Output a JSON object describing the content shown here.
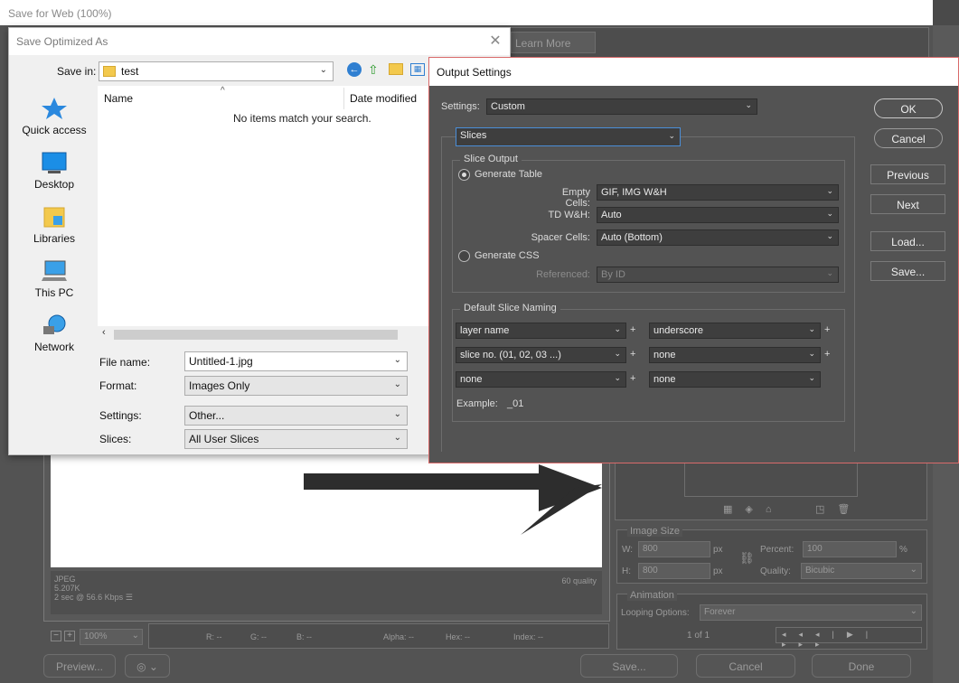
{
  "sfw": {
    "title": "Save for Web (100%)",
    "learn_more": "Learn More",
    "canvas_info": {
      "format": "JPEG",
      "size": "5.207K",
      "time": "2 sec @ 56.6 Kbps",
      "quality": "60 quality"
    },
    "zoom": "100%",
    "readouts": {
      "r": "R: --",
      "g": "G: --",
      "b": "B: --",
      "alpha": "Alpha: --",
      "hex": "Hex: --",
      "index": "Index: --"
    },
    "preview_button": "Preview...",
    "save_button": "Save...",
    "cancel_button": "Cancel",
    "done_button": "Done",
    "image_size": {
      "title": "Image Size",
      "w_label": "W:",
      "w_value": "800",
      "h_label": "H:",
      "h_value": "800",
      "unit": "px",
      "percent_label": "Percent:",
      "percent_value": "100",
      "percent_unit": "%",
      "quality_label": "Quality:",
      "quality_value": "Bicubic"
    },
    "animation": {
      "title": "Animation",
      "looping_label": "Looping Options:",
      "looping_value": "Forever",
      "frame": "1 of 1"
    }
  },
  "save_dialog": {
    "title": "Save Optimized As",
    "save_in_label": "Save in:",
    "save_in_value": "test",
    "places": [
      "Quick access",
      "Desktop",
      "Libraries",
      "This PC",
      "Network"
    ],
    "columns": {
      "name": "Name",
      "date": "Date modified"
    },
    "empty_message": "No items match your search.",
    "file_name_label": "File name:",
    "file_name_value": "Untitled-1.jpg",
    "format_label": "Format:",
    "format_value": "Images Only",
    "settings_label": "Settings:",
    "settings_value": "Other...",
    "slices_label": "Slices:",
    "slices_value": "All User Slices"
  },
  "output_settings": {
    "title": "Output Settings",
    "settings_label": "Settings:",
    "settings_value": "Custom",
    "section_value": "Slices",
    "slice_output_title": "Slice Output",
    "generate_table": "Generate Table",
    "empty_cells_label": "Empty Cells:",
    "empty_cells_value": "GIF, IMG W&H",
    "td_wh_label": "TD W&H:",
    "td_wh_value": "Auto",
    "spacer_cells_label": "Spacer Cells:",
    "spacer_cells_value": "Auto (Bottom)",
    "generate_css": "Generate CSS",
    "referenced_label": "Referenced:",
    "referenced_value": "By ID",
    "naming_title": "Default Slice Naming",
    "naming": [
      {
        "a": "layer name",
        "b": "underscore"
      },
      {
        "a": "slice no. (01, 02, 03 ...)",
        "b": "none"
      },
      {
        "a": "none",
        "b": "none"
      }
    ],
    "plus": "+",
    "example_label": "Example:",
    "example_value": "_01",
    "buttons": {
      "ok": "OK",
      "cancel": "Cancel",
      "previous": "Previous",
      "next": "Next",
      "load": "Load...",
      "save": "Save..."
    }
  }
}
